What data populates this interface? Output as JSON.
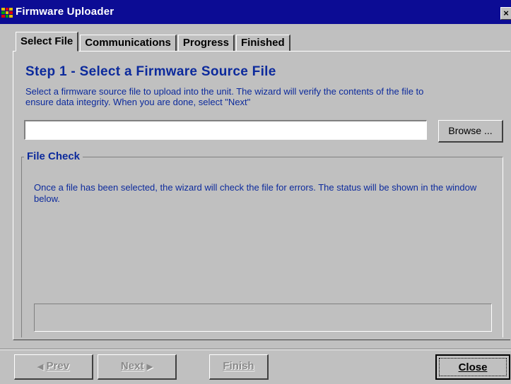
{
  "window": {
    "title": "Firmware Uploader",
    "close_glyph": "×",
    "icon": "app-icon"
  },
  "tabs": [
    {
      "label": "Select File",
      "active": true
    },
    {
      "label": "Communications",
      "active": false
    },
    {
      "label": "Progress",
      "active": false
    },
    {
      "label": "Finished",
      "active": false
    }
  ],
  "step": {
    "title": "Step 1 - Select a Firmware Source File",
    "description": "Select a firmware source file to upload into the unit.  The wizard will verify the contents of the file to ensure data integrity.  When you are done, select \"Next\""
  },
  "file_field": {
    "value": "",
    "browse_label": "Browse ..."
  },
  "file_check": {
    "label": "File Check",
    "text": "Once a file has been selected, the wizard will check the file for errors.  The status will be shown in the window below.",
    "status": ""
  },
  "buttons": {
    "prev_label": "Prev",
    "prev_arrow": "◀",
    "next_label": "Next",
    "next_arrow": "▶",
    "finish_label": "Finish",
    "close_label": "Close"
  },
  "colors": {
    "title_bar": "#0c0c94",
    "accent_text": "#0c2a9c",
    "dialog_face": "#c0c0c0"
  }
}
